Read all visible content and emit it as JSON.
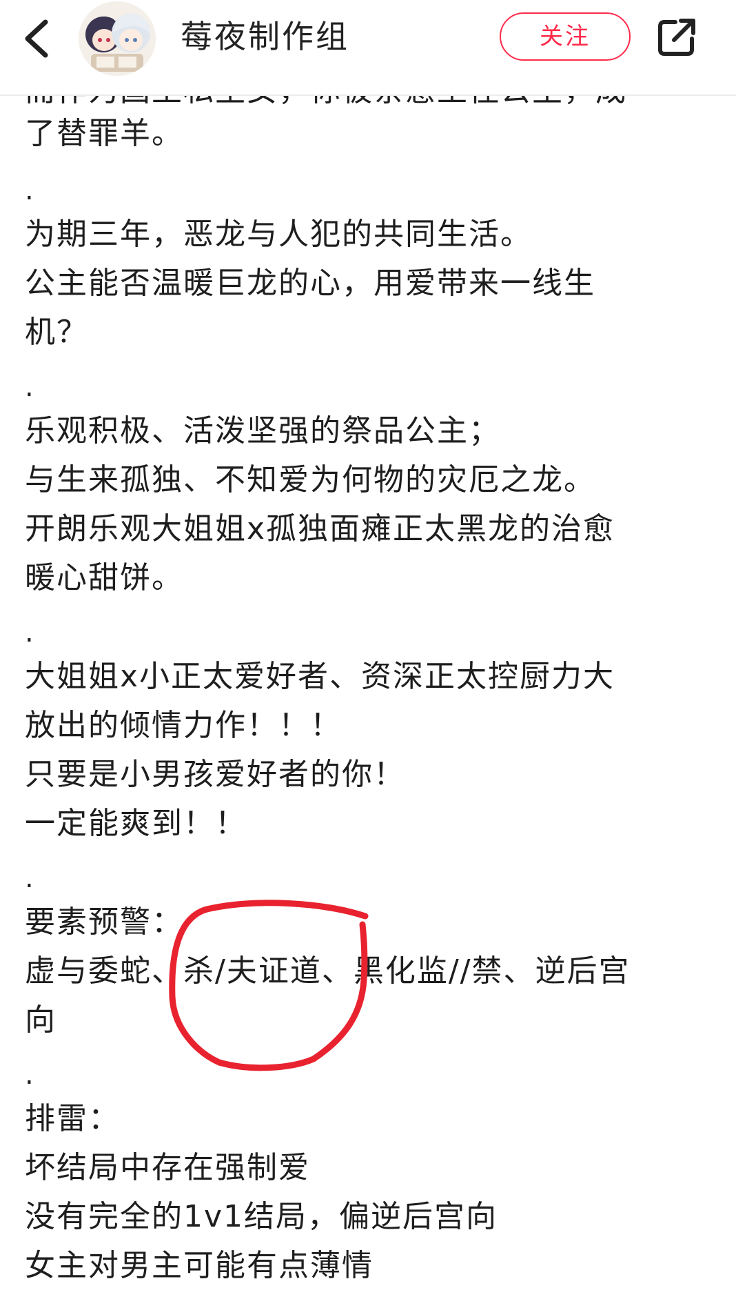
{
  "header": {
    "account_name": "莓夜制作组",
    "follow_label": "关注",
    "back_icon": "chevron-left-icon",
    "share_icon": "share-icon"
  },
  "article": {
    "lines": [
      "而作为国王私生女，你被亲惠王住公主，成",
      "了替罪羊。",
      ".",
      "为期三年，恶龙与人犯的共同生活。",
      "公主能否温暖巨龙的心，用爱带来一线生",
      "机？",
      ".",
      "乐观积极、活泼坚强的祭品公主；",
      "与生来孤独、不知爱为何物的灾厄之龙。",
      "开朗乐观大姐姐x孤独面瘫正太黑龙的治愈",
      "暖心甜饼。",
      ".",
      "大姐姐x小正太爱好者、资深正太控厨力大",
      "放出的倾情力作！！！",
      "只要是小男孩爱好者的你！",
      "一定能爽到！！",
      ".",
      "要素预警：",
      "虚与委蛇、杀/夫证道、黑化监//禁、逆后宫",
      "向",
      ".",
      "排雷：",
      "坏结局中存在强制爱",
      "没有完全的1v1结局，偏逆后宫向",
      "女主对男主可能有点薄情"
    ]
  },
  "colors": {
    "accent": "#ff2a4a",
    "text": "#1e1e1e",
    "annotation": "#e8232f"
  }
}
